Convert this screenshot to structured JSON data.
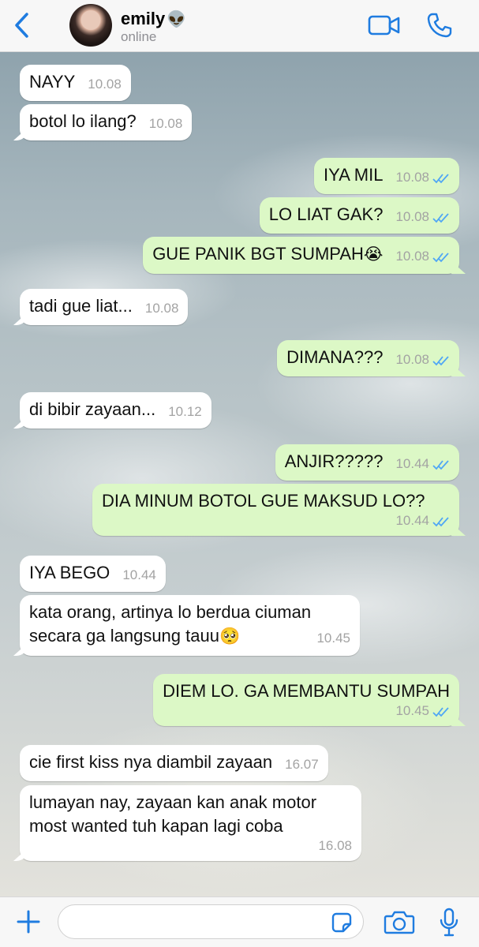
{
  "header": {
    "contact_name": "emily",
    "name_emoji": "👽",
    "status": "online"
  },
  "colors": {
    "accent": "#1f7ce0",
    "incoming_bubble": "#ffffff",
    "outgoing_bubble": "#dcf8c6",
    "read_ticks": "#4fa6f5",
    "timestamp": "#a3a3a3"
  },
  "messages": [
    {
      "dir": "in",
      "text": "NAYY",
      "time": "10.08"
    },
    {
      "dir": "in",
      "text": "botol lo ilang?",
      "time": "10.08"
    },
    {
      "dir": "out",
      "text": "IYA MIL",
      "time": "10.08",
      "read": true
    },
    {
      "dir": "out",
      "text": "LO LIAT GAK?",
      "time": "10.08",
      "read": true
    },
    {
      "dir": "out",
      "text": "GUE PANIK BGT SUMPAH",
      "emoji": "😭",
      "time": "10.08",
      "read": true
    },
    {
      "dir": "in",
      "text": "tadi gue liat...",
      "time": "10.08"
    },
    {
      "dir": "out",
      "text": "DIMANA???",
      "time": "10.08",
      "read": true
    },
    {
      "dir": "in",
      "text": "di bibir zayaan...",
      "time": "10.12"
    },
    {
      "dir": "out",
      "text": "ANJIR?????",
      "time": "10.44",
      "read": true
    },
    {
      "dir": "out",
      "text": "DIA MINUM BOTOL GUE MAKSUD LO??",
      "time": "10.44",
      "read": true
    },
    {
      "dir": "in",
      "text": "IYA BEGO",
      "time": "10.44"
    },
    {
      "dir": "in",
      "text": "kata orang, artinya lo berdua ciuman\nsecara ga langsung tauu",
      "emoji": "🥺",
      "time": "10.45"
    },
    {
      "dir": "out",
      "text": "DIEM LO. GA MEMBANTU SUMPAH",
      "time": "10.45",
      "read": true
    },
    {
      "dir": "in",
      "text": "cie first kiss nya diambil zayaan",
      "time": "16.07"
    },
    {
      "dir": "in",
      "text": "lumayan nay, zayaan kan anak motor\nmost wanted tuh kapan lagi coba",
      "time": "16.08"
    }
  ],
  "input": {
    "value": "",
    "placeholder": ""
  },
  "icons": {
    "back": "chevron-left-icon",
    "video": "video-camera-icon",
    "call": "phone-icon",
    "add": "plus-icon",
    "sticker": "sticker-icon",
    "camera": "camera-icon",
    "mic": "microphone-icon"
  }
}
